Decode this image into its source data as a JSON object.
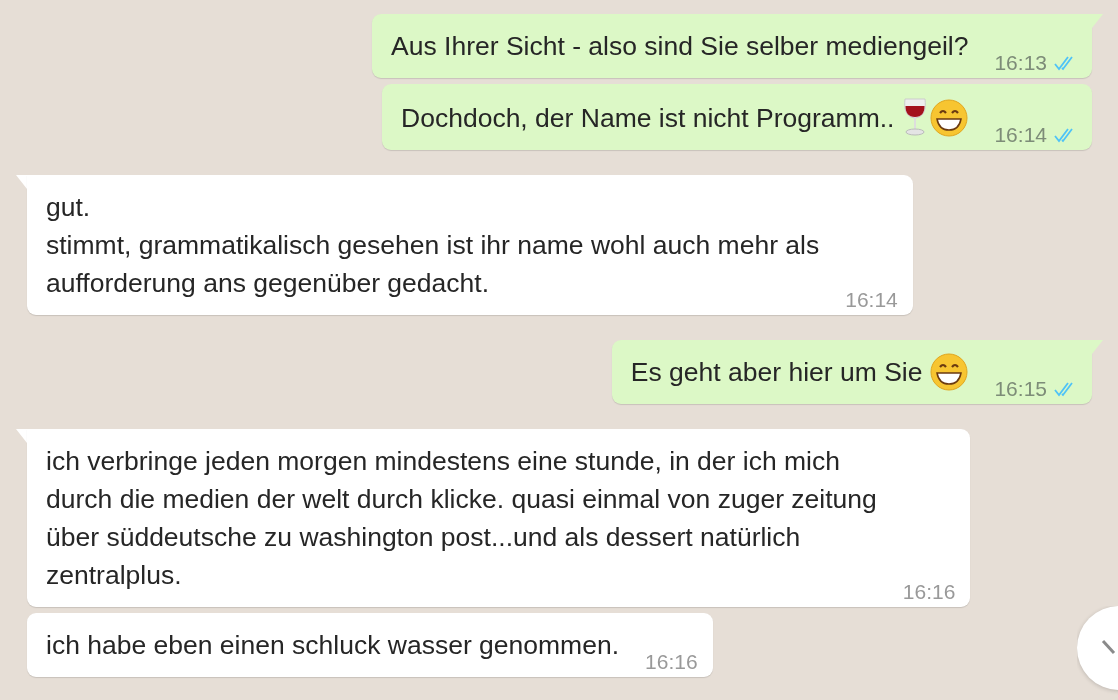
{
  "messages": [
    {
      "kind": "outgoing",
      "tail": true,
      "text": "Aus Ihrer Sicht - also sind Sie selber mediengeil?",
      "time": "16:13",
      "read": true
    },
    {
      "kind": "outgoing",
      "tail": false,
      "text": "Dochdoch, der Name ist nicht Programm..",
      "emoji": [
        {
          "kind": "wine"
        },
        {
          "kind": "grin"
        }
      ],
      "time": "16:14",
      "read": true
    },
    {
      "kind": "incoming",
      "tail": true,
      "text": "gut.\nstimmt, grammatikalisch gesehen ist ihr name wohl auch mehr als\naufforderung ans gegenüber gedacht.",
      "time": "16:14"
    },
    {
      "kind": "outgoing",
      "tail": true,
      "text": "Es geht aber hier um Sie",
      "emoji": [
        {
          "kind": "grin"
        }
      ],
      "time": "16:15",
      "read": true
    },
    {
      "kind": "incoming",
      "tail": true,
      "text": "ich verbringe jeden morgen mindestens eine stunde, in der ich mich\ndurch die medien der welt durch klicke. quasi einmal von zuger zeitung\nüber süddeutsche zu washington post...und als dessert natürlich\nzentralplus.",
      "time": "16:16"
    },
    {
      "kind": "incoming",
      "tail": false,
      "text": "ich habe eben einen schluck wasser genommen.",
      "time": "16:16"
    }
  ],
  "scroll_button": {
    "kind": "scroll-down"
  }
}
